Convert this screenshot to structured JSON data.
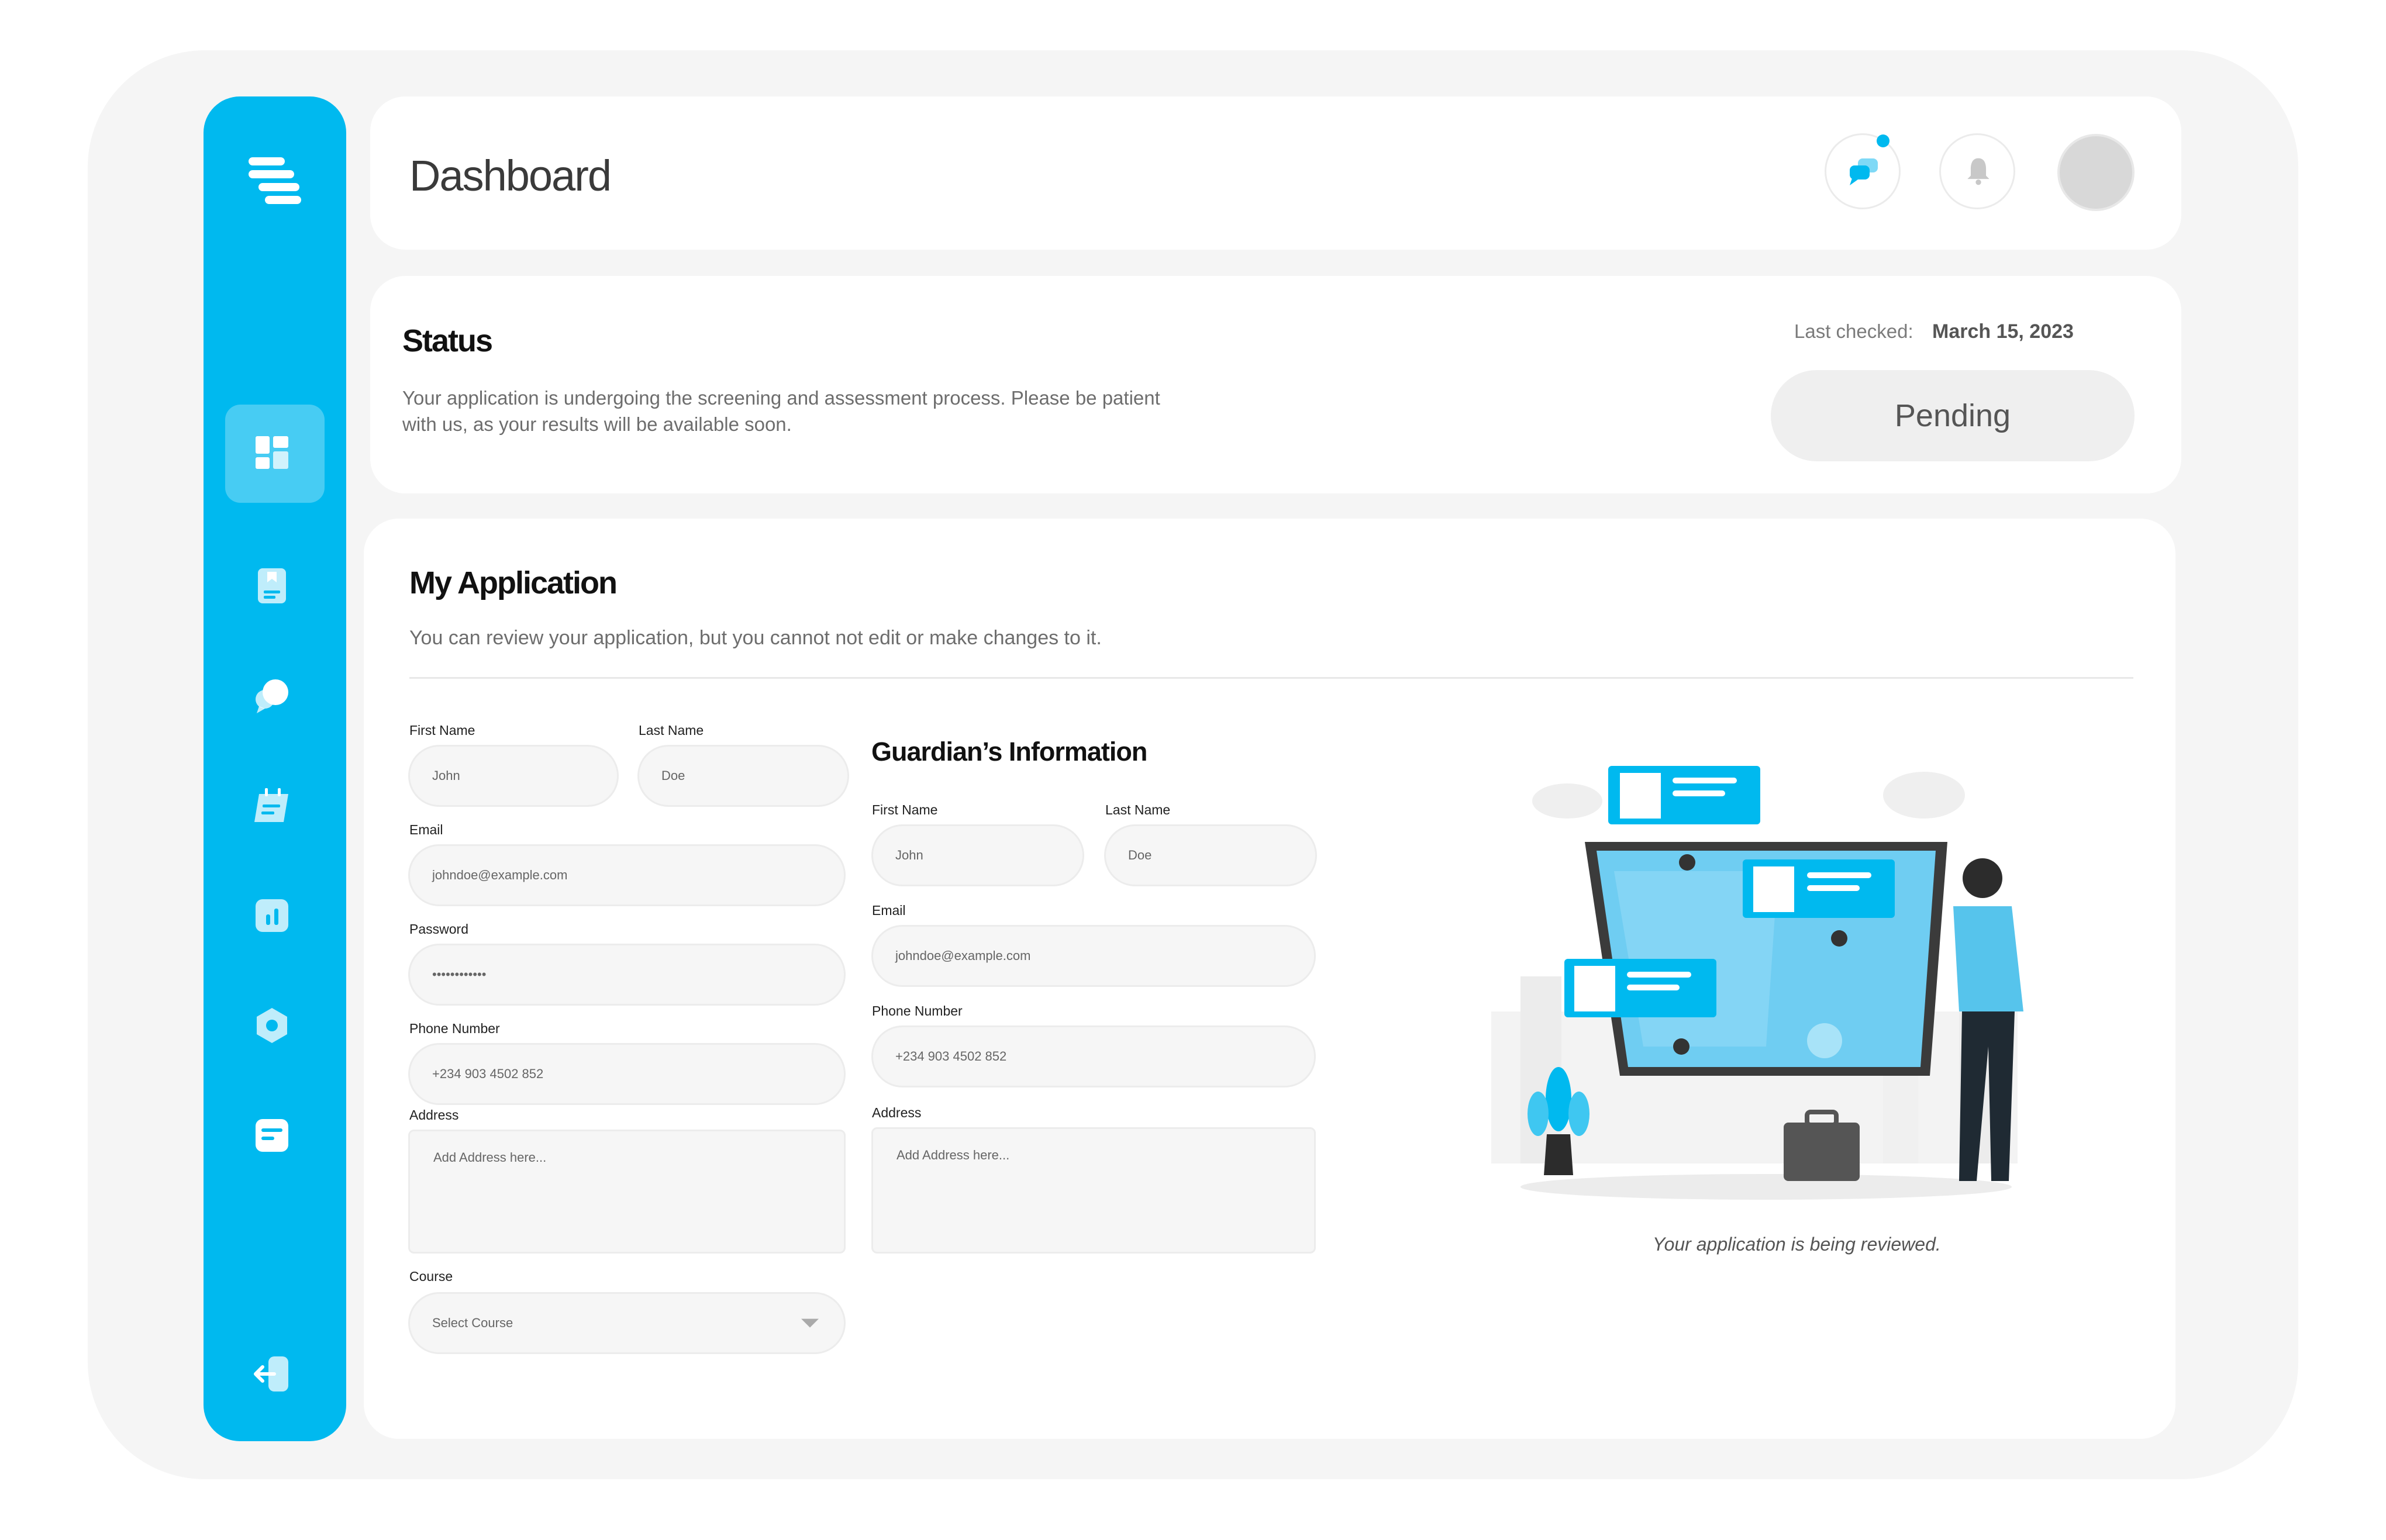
{
  "header": {
    "title": "Dashboard"
  },
  "icons": {
    "logo": "stack-logo-icon",
    "nav": [
      "dashboard-icon",
      "document-icon",
      "chat-icon",
      "calendar-icon",
      "chart-icon",
      "settings-hexagon-icon",
      "list-icon",
      "logout-icon"
    ],
    "header": [
      "messages-icon",
      "bell-icon"
    ]
  },
  "status": {
    "title": "Status",
    "description": "Your application is undergoing the screening and assessment process. Please be patient with us, as your results will be available soon.",
    "last_checked_label": "Last checked:",
    "last_checked_date": "March 15, 2023",
    "badge": "Pending"
  },
  "application": {
    "title": "My Application",
    "description": "You can review your application, but you cannot not edit or make changes to it.",
    "first_name_label": "First Name",
    "first_name_value": "John",
    "last_name_label": "Last Name",
    "last_name_value": "Doe",
    "email_label": "Email",
    "email_value": "johndoe@example.com",
    "password_label": "Password",
    "password_value": "••••••••••••",
    "phone_label": "Phone Number",
    "phone_value": "+234 903 4502 852",
    "address_label": "Address",
    "address_placeholder": "Add Address here...",
    "course_label": "Course",
    "course_value": "Select Course"
  },
  "guardian": {
    "title": "Guardian’s Information",
    "first_name_label": "First Name",
    "first_name_value": "John",
    "last_name_label": "Last Name",
    "last_name_value": "Doe",
    "email_label": "Email",
    "email_value": "johndoe@example.com",
    "phone_label": "Phone Number",
    "phone_value": "+234 903 4502 852",
    "address_label": "Address",
    "address_placeholder": "Add Address here..."
  },
  "illustration": {
    "caption": "Your application is being reviewed."
  },
  "colors": {
    "accent": "#00b9ef",
    "background": "#f5f5f5",
    "card": "#ffffff"
  }
}
